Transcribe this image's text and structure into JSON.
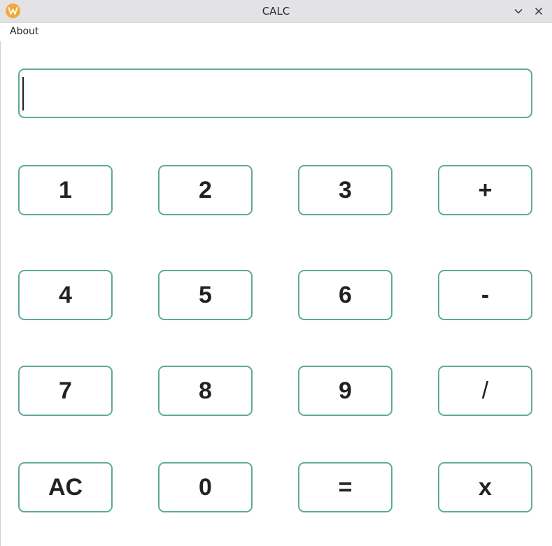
{
  "window": {
    "title": "CALC",
    "logo_icon": "w-app-icon",
    "logo_letter": "W",
    "accent": "#5fa99a"
  },
  "menu": {
    "items": [
      {
        "label": "About"
      }
    ]
  },
  "display": {
    "value": "",
    "placeholder": ""
  },
  "keys": [
    [
      "1",
      "2",
      "3",
      "+"
    ],
    [
      "4",
      "5",
      "6",
      "-"
    ],
    [
      "7",
      "8",
      "9",
      "/"
    ],
    [
      "AC",
      "0",
      "=",
      "x"
    ]
  ]
}
